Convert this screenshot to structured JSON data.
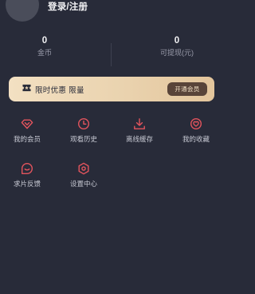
{
  "header": {
    "login_label": "登录/注册"
  },
  "stats": {
    "coins": {
      "value": "0",
      "label": "金币"
    },
    "withdrawable": {
      "value": "0",
      "label": "可提现(元)"
    }
  },
  "promo": {
    "text": "限时优惠 限量",
    "button_label": "开通会员",
    "icon": "ticket-icon"
  },
  "menu": [
    {
      "label": "我的会员",
      "icon": "diamond-icon"
    },
    {
      "label": "观看历史",
      "icon": "clock-icon"
    },
    {
      "label": "离线缓存",
      "icon": "download-icon"
    },
    {
      "label": "我的收藏",
      "icon": "heart-icon"
    },
    {
      "label": "求片反馈",
      "icon": "feedback-icon"
    },
    {
      "label": "设置中心",
      "icon": "settings-icon"
    }
  ],
  "colors": {
    "background": "#282b39",
    "accent": "#e3545d",
    "promo_gradient_start": "#f3e0c2",
    "promo_gradient_end": "#e3c59c",
    "promo_button": "#594439"
  }
}
